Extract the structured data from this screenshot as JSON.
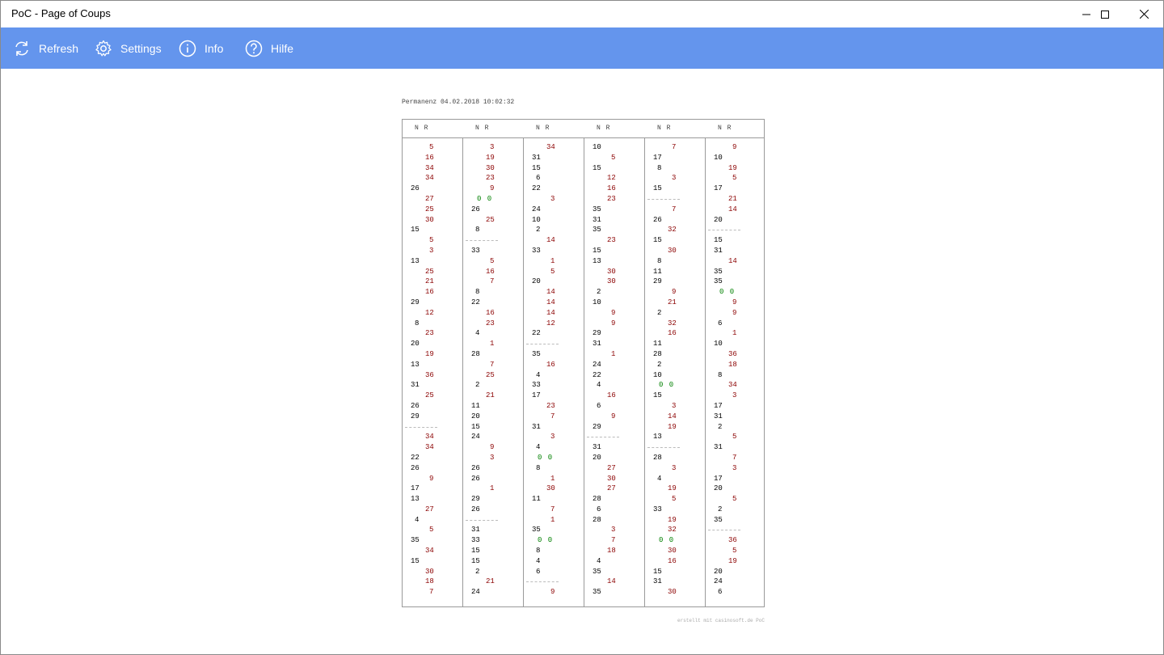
{
  "window": {
    "title": "PoC - Page of Coups"
  },
  "toolbar": {
    "refresh_label": "Refresh",
    "settings_label": "Settings",
    "info_label": "Info",
    "hilfe_label": "Hilfe"
  },
  "colors": {
    "accent": "#6495ed",
    "red_number": "#8b0000",
    "zero": "#008000"
  },
  "sheet": {
    "permanenz_label": "Permanenz 04.02.2018 10:02:32",
    "header_label": "N R",
    "footer": "erstellt mit casinosoft.de PoC",
    "columns": [
      [
        "r:5",
        "r:16",
        "r:34",
        "r:34",
        "n:26",
        "r:27",
        "r:25",
        "r:30",
        "n:15",
        "r:5",
        "r:3",
        "n:13",
        "r:25",
        "r:21",
        "r:16",
        "n:29",
        "r:12",
        "n:8",
        "r:23",
        "n:20",
        "r:19",
        "n:13",
        "r:36",
        "n:31",
        "r:25",
        "n:26",
        "n:29",
        "sep",
        "r:34",
        "r:34",
        "n:22",
        "n:26",
        "r:9",
        "n:17",
        "n:13",
        "r:27",
        "n:4",
        "r:5",
        "n:35",
        "r:34",
        "n:15",
        "r:30",
        "r:18",
        "r:7"
      ],
      [
        "r:3",
        "r:19",
        "r:30",
        "r:23",
        "r:9",
        "z:0 0",
        "n:26",
        "r:25",
        "n:8",
        "sep",
        "n:33",
        "r:5",
        "r:16",
        "r:7",
        "n:8",
        "n:22",
        "r:16",
        "r:23",
        "n:4",
        "r:1",
        "n:28",
        "r:7",
        "r:25",
        "n:2",
        "r:21",
        "n:11",
        "n:20",
        "n:15",
        "n:24",
        "r:9",
        "r:3",
        "n:26",
        "n:26",
        "r:1",
        "n:29",
        "n:26",
        "sep",
        "n:31",
        "n:33",
        "n:15",
        "n:15",
        "n:2",
        "r:21",
        "n:24"
      ],
      [
        "r:34",
        "n:31",
        "n:15",
        "n:6",
        "n:22",
        "r:3",
        "n:24",
        "n:10",
        "n:2",
        "r:14",
        "n:33",
        "r:1",
        "r:5",
        "n:20",
        "r:14",
        "r:14",
        "r:14",
        "r:12",
        "n:22",
        "sep",
        "n:35",
        "r:16",
        "n:4",
        "n:33",
        "n:17",
        "r:23",
        "r:7",
        "n:31",
        "r:3",
        "n:4",
        "z:0 0",
        "n:8",
        "r:1",
        "r:30",
        "n:11",
        "r:7",
        "r:1",
        "n:35",
        "z:0 0",
        "n:8",
        "n:4",
        "n:6",
        "sep",
        "r:9"
      ],
      [
        "n:10",
        "r:5",
        "n:15",
        "r:12",
        "r:16",
        "r:23",
        "n:35",
        "n:31",
        "n:35",
        "r:23",
        "n:15",
        "n:13",
        "r:30",
        "r:30",
        "n:2",
        "n:10",
        "r:9",
        "r:9",
        "n:29",
        "n:31",
        "r:1",
        "n:24",
        "n:22",
        "n:4",
        "r:16",
        "n:6",
        "r:9",
        "n:29",
        "sep",
        "n:31",
        "n:20",
        "r:27",
        "r:30",
        "r:27",
        "n:28",
        "n:6",
        "n:28",
        "r:3",
        "r:7",
        "r:18",
        "n:4",
        "n:35",
        "r:14",
        "n:35"
      ],
      [
        "r:7",
        "n:17",
        "n:8",
        "r:3",
        "n:15",
        "sep",
        "r:7",
        "n:26",
        "r:32",
        "n:15",
        "r:30",
        "n:8",
        "n:11",
        "n:29",
        "r:9",
        "r:21",
        "n:2",
        "r:32",
        "r:16",
        "n:11",
        "n:28",
        "n:2",
        "n:10",
        "z:0 0",
        "n:15",
        "r:3",
        "r:14",
        "r:19",
        "n:13",
        "sep",
        "n:28",
        "r:3",
        "n:4",
        "r:19",
        "r:5",
        "n:33",
        "r:19",
        "r:32",
        "z:0 0",
        "r:30",
        "r:16",
        "n:15",
        "n:31",
        "r:30"
      ],
      [
        "r:9",
        "n:10",
        "r:19",
        "r:5",
        "n:17",
        "r:21",
        "r:14",
        "n:20",
        "sep",
        "n:15",
        "n:31",
        "r:14",
        "n:35",
        "n:35",
        "z:0 0",
        "r:9",
        "r:9",
        "n:6",
        "r:1",
        "n:10",
        "r:36",
        "r:18",
        "n:8",
        "r:34",
        "r:3",
        "n:17",
        "n:31",
        "n:2",
        "r:5",
        "n:31",
        "r:7",
        "r:3",
        "n:17",
        "n:20",
        "r:5",
        "n:2",
        "n:35",
        "sep",
        "r:36",
        "r:5",
        "r:19",
        "n:20",
        "n:24",
        "n:6"
      ]
    ]
  }
}
